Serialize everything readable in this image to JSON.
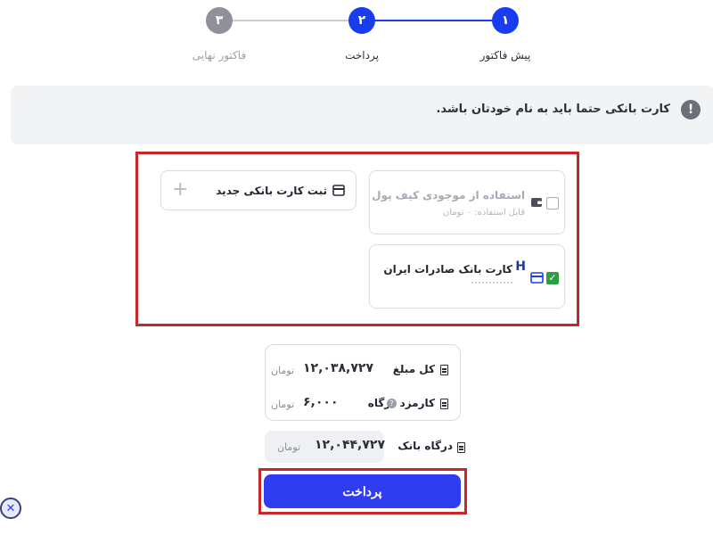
{
  "stepper": {
    "steps": [
      {
        "number": "۱",
        "label": "پیش فاکتور"
      },
      {
        "number": "۲",
        "label": "پرداخت"
      },
      {
        "number": "۳",
        "label": "فاکتور نهایی"
      }
    ],
    "colors": {
      "active": "#1a3cf0",
      "inactive": "#8e9199"
    }
  },
  "notice": {
    "icon": "exclamation-icon",
    "text": "کارت بانکی حتما باید به نام خودتان باشد."
  },
  "payment_methods": {
    "wallet": {
      "title": "استفاده از موجودی کیف پول",
      "subtitle": "قابل استفاده: ۰ تومان",
      "checked": false,
      "icon": "wallet-icon"
    },
    "bank_card": {
      "title": "کارت بانک صادرات ایران",
      "checked": true,
      "icon": "card-icon",
      "bank_logo": "H"
    },
    "new_card": {
      "label": "ثبت کارت بانکی جدید",
      "icon": "card-icon",
      "add_icon": "plus-icon"
    }
  },
  "summary": {
    "total": {
      "label": "کل مبلغ",
      "amount": "۱۲,۰۳۸,۷۲۷",
      "unit": "تومان"
    },
    "fee": {
      "label": "کارمزد درگاه",
      "amount": "۶,۰۰۰",
      "unit": "تومان",
      "info_icon": "info-icon"
    }
  },
  "gateway": {
    "label": "درگاه بانک",
    "amount": "۱۲,۰۴۴,۷۲۷",
    "unit": "تومان"
  },
  "pay_button": {
    "label": "پرداخت"
  },
  "highlight_color": "#c62828"
}
